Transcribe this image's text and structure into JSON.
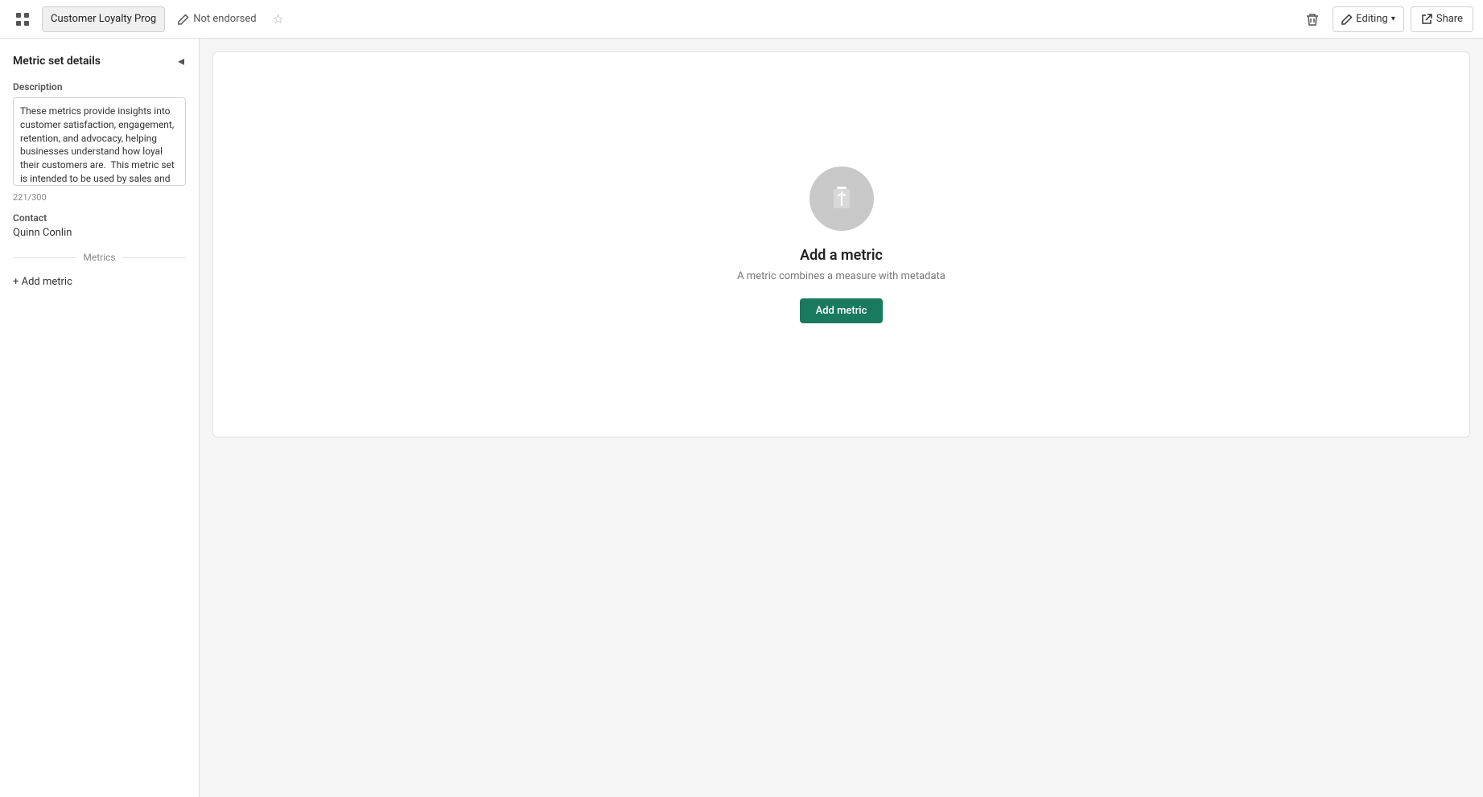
{
  "header": {
    "grid_icon": "⊞",
    "breadcrumb_label": "Customer Loyalty Prog",
    "not_endorsed_label": "Not endorsed",
    "star_icon": "☆",
    "delete_icon": "🗑",
    "editing_label": "Editing",
    "chevron_icon": "▾",
    "share_icon": "↗",
    "share_label": "Share"
  },
  "sidebar": {
    "title": "Metric set details",
    "collapse_icon": "◂",
    "description_label": "Description",
    "description_value": "These metrics provide insights into customer satisfaction, engagement, retention, and advocacy, helping businesses understand how loyal their customers are.  This metric set is intended to be used by sales and CSAT teams",
    "char_count": "221/300",
    "contact_label": "Contact",
    "contact_value": "Quinn Conlin",
    "metrics_section_label": "Metrics",
    "add_metric_label": "+ Add metric"
  },
  "main": {
    "empty_state_title": "Add a metric",
    "empty_state_subtitle": "A metric combines a measure with metadata",
    "add_metric_button_label": "Add metric"
  }
}
